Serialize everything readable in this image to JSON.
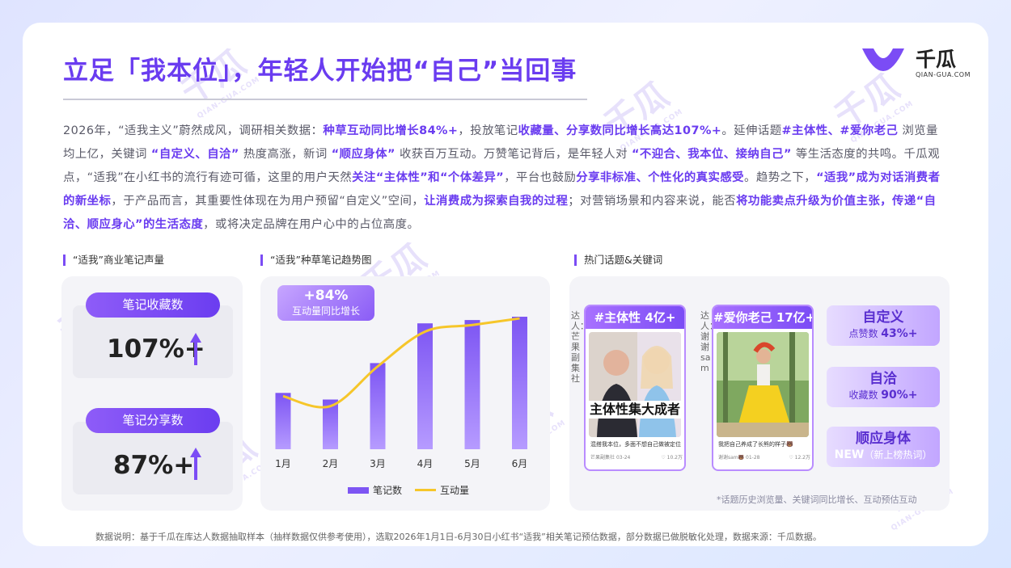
{
  "header": {
    "title": "立足「我本位」，年轻人开始把“自己”当回事",
    "logo_name": "千瓜",
    "logo_sub": "QIAN-GUA.COM"
  },
  "paragraph": [
    {
      "t": "2026年，“适我主义”蔚然成风，调研相关数据：",
      "b": false
    },
    {
      "t": "种草互动同比增长84%+",
      "b": true
    },
    {
      "t": "，投放笔记",
      "b": false
    },
    {
      "t": "收藏量、分享数同比增长高达107%+",
      "b": true
    },
    {
      "t": "。延伸话题",
      "b": false
    },
    {
      "t": "#主体性、#爱你老己",
      "b": true
    },
    {
      "t": " 浏览量均上亿，关键词 ",
      "b": false
    },
    {
      "t": "“自定义、自洽”",
      "b": true
    },
    {
      "t": " 热度高涨，新词 ",
      "b": false
    },
    {
      "t": "“顺应身体”",
      "b": true
    },
    {
      "t": " 收获百万互动。万赞笔记背后，是年轻人对 ",
      "b": false
    },
    {
      "t": "“不迎合、我本位、接纳自己”",
      "b": true
    },
    {
      "t": " 等生活态度的共鸣。千瓜观点，“适我”在小红书的流行有迹可循，这里的用户天然",
      "b": false
    },
    {
      "t": "关注“主体性”和“个体差异”",
      "b": true
    },
    {
      "t": "，平台也鼓励",
      "b": false
    },
    {
      "t": "分享非标准、个性化的真实感受",
      "b": true
    },
    {
      "t": "。趋势之下，",
      "b": false
    },
    {
      "t": "“适我”成为对话消费者的新坐标",
      "b": true
    },
    {
      "t": "，于产品而言，其重要性体现在为用户预留“自定义”空间，",
      "b": false
    },
    {
      "t": "让消费成为探索自我的过程",
      "b": true
    },
    {
      "t": "；对营销场景和内容来说，能否",
      "b": false
    },
    {
      "t": "将功能卖点升级为价值主张，传递“自洽、顺应身心”的生活态度",
      "b": true
    },
    {
      "t": "，或将决定品牌在用户心中的占位高度。",
      "b": false
    }
  ],
  "sections": {
    "volume": "“适我”商业笔记声量",
    "trend": "“适我”种草笔记趋势图",
    "topics": "热门话题&关键词"
  },
  "stats": [
    {
      "label": "笔记收藏数",
      "value": "107%+"
    },
    {
      "label": "笔记分享数",
      "value": "87%+"
    }
  ],
  "badge": {
    "value": "+84%",
    "label": "互动量同比增长"
  },
  "chart_data": {
    "type": "bar",
    "categories": [
      "1月",
      "2月",
      "3月",
      "4月",
      "5月",
      "6月"
    ],
    "series": [
      {
        "name": "笔记数",
        "type": "bar",
        "values": [
          34,
          30,
          52,
          76,
          78,
          80
        ]
      },
      {
        "name": "互动量",
        "type": "line",
        "values": [
          32,
          26,
          50,
          71,
          75,
          79
        ]
      }
    ],
    "ylim": [
      0,
      100
    ],
    "legend": "bottom",
    "grid": false,
    "colors": {
      "bar": "#7d55f3",
      "line": "#f6c62a"
    }
  },
  "posts": [
    {
      "tag": "#主体性",
      "num": "4亿+",
      "author": "达人：芒果副集社",
      "overlay": "主体性集大成者",
      "caption": "混搭我本位，多面不想自己做被定位",
      "user": "芒果副集社",
      "date": "03-24",
      "likes": "♡ 10.2万"
    },
    {
      "tag": "#爱你老己",
      "num": "17亿+",
      "author": "达人：谢谢sam",
      "overlay": "",
      "caption": "我把自己养成了长熊的样子🐻",
      "user": "谢谢sam🐻",
      "date": "01-28",
      "likes": "♡ 12.2万"
    }
  ],
  "keywords": [
    {
      "title": "自定义",
      "sub": "点赞数",
      "value": "43%+"
    },
    {
      "title": "自洽",
      "sub": "收藏数",
      "value": "90%+"
    },
    {
      "title": "顺应身体",
      "sub": "NEW",
      "value": "（新上榜热词）"
    }
  ],
  "footnote": "*话题历史浏览量、关键词同比增长、互动预估互动",
  "datanote": "数据说明：基于千瓜在库达人数据抽取样本（抽样数据仅供参考使用），选取2026年1月1日-6月30日小红书“适我”相关笔记预估数据，部分数据已做脱敏化处理，数据来源：千瓜数据。"
}
